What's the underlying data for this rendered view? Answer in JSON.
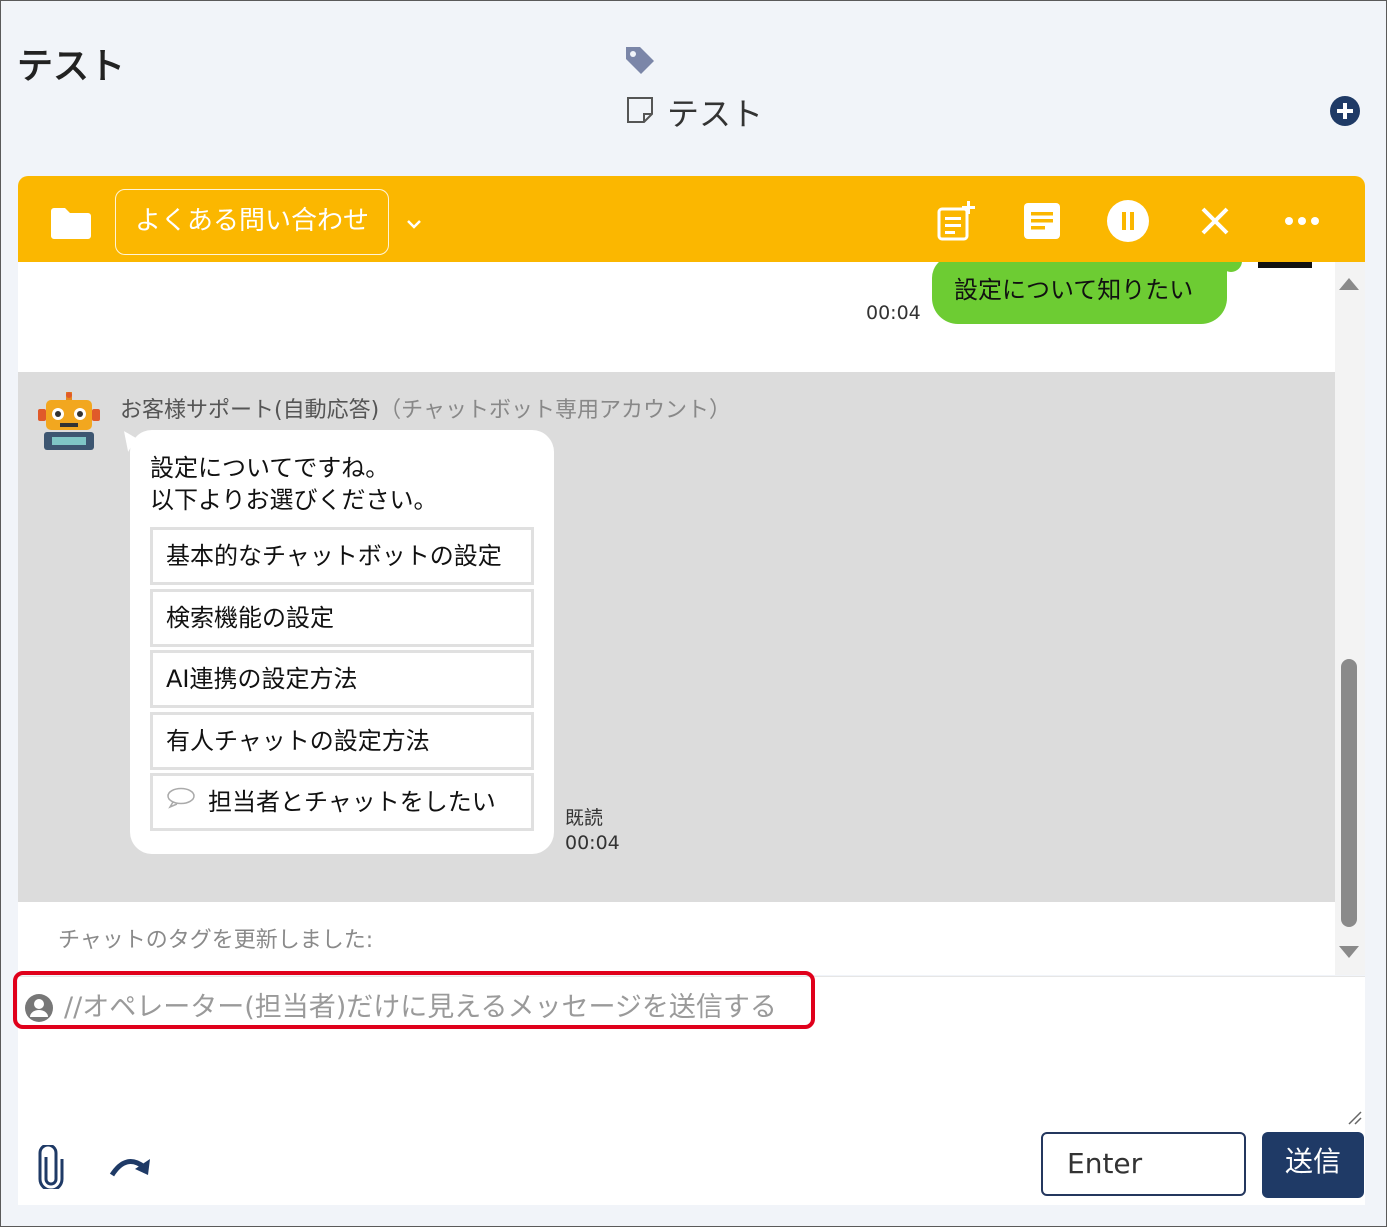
{
  "header": {
    "title": "テスト",
    "note_label": "テスト"
  },
  "toolbar": {
    "category_label": "よくある問い合わせ",
    "color": "#fbb700"
  },
  "chat": {
    "user_message": {
      "text": "設定について知りたい",
      "time": "00:04"
    },
    "bot": {
      "name": "お客様サポート(自動応答)",
      "account_type": "（チャットボット専用アカウント）",
      "message_line1": "設定についてですね。",
      "message_line2": "以下よりお選びください。",
      "choices": [
        "基本的なチャットボットの設定",
        "検索機能の設定",
        "AI連携の設定方法",
        "有人チャットの設定方法",
        "担当者とチャットをしたい"
      ],
      "read_status": "既読",
      "time": "00:04"
    },
    "system_message": "チャットのタグを更新しました:"
  },
  "composer": {
    "placeholder": "//オペレーター(担当者)だけに見えるメッセージを送信する",
    "enter_mode": "Enter",
    "send_label": "送信"
  },
  "colors": {
    "accent": "#fbb700",
    "user_bubble": "#6dcc33",
    "send_button": "#1f3a66",
    "highlight": "#e0001b"
  }
}
